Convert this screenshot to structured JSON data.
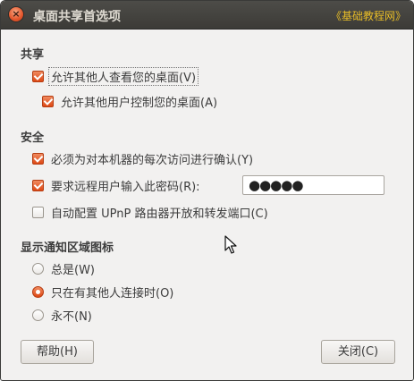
{
  "window": {
    "title": "桌面共享首选项",
    "watermark": "《基础教程网》",
    "close_glyph": "×"
  },
  "sharing": {
    "heading": "共享",
    "allow_view": {
      "label": "允许其他人查看您的桌面(V)",
      "checked": true
    },
    "allow_control": {
      "label": "允许其他用户控制您的桌面(A)",
      "checked": true
    }
  },
  "security": {
    "heading": "安全",
    "confirm_each": {
      "label": "必须为对本机器的每次访问进行确认(Y)",
      "checked": true
    },
    "require_password": {
      "label": "要求远程用户输入此密码(R):",
      "checked": true
    },
    "password_value": "●●●●●",
    "upnp": {
      "label": "自动配置 UPnP 路由器开放和转发端口(C)",
      "checked": false
    }
  },
  "notification": {
    "heading": "显示通知区域图标",
    "options": [
      {
        "label": "总是(W)",
        "selected": false
      },
      {
        "label": "只在有其他人连接时(O)",
        "selected": true
      },
      {
        "label": "永不(N)",
        "selected": false
      }
    ]
  },
  "buttons": {
    "help": "帮助(H)",
    "close": "关闭(C)"
  },
  "colors": {
    "accent": "#dd4814",
    "titlebar": "#3c3b37",
    "watermark": "#e8bd27",
    "window_bg": "#f2f1f0"
  }
}
